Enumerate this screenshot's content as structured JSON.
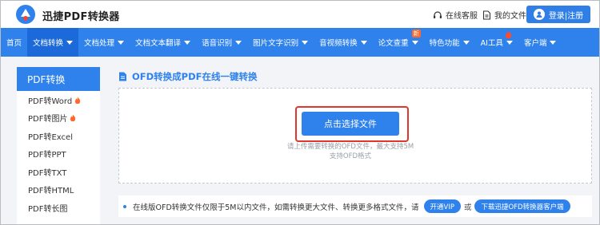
{
  "header": {
    "brand": "迅捷PDF转换器",
    "service": "在线客服",
    "my_files": "我的文件",
    "login": "登录|注册"
  },
  "nav": {
    "items": [
      {
        "label": "首页",
        "caret": false
      },
      {
        "label": "文档转换",
        "caret": true,
        "active": true
      },
      {
        "label": "文档处理",
        "caret": true
      },
      {
        "label": "文档文本翻译",
        "caret": true
      },
      {
        "label": "语音识别",
        "caret": true
      },
      {
        "label": "图片文字识别",
        "caret": true
      },
      {
        "label": "音视频转换",
        "caret": true
      },
      {
        "label": "论文查重",
        "caret": true,
        "badge": "新"
      },
      {
        "label": "特色功能",
        "caret": true
      },
      {
        "label": "AI工具",
        "caret": true,
        "fire": true
      },
      {
        "label": "客户端",
        "caret": true
      }
    ]
  },
  "sidebar": {
    "title": "PDF转换",
    "items": [
      {
        "label": "PDF转Word",
        "hot": true
      },
      {
        "label": "PDF转图片",
        "hot": true
      },
      {
        "label": "PDF转Excel",
        "hot": false
      },
      {
        "label": "PDF转PPT",
        "hot": false
      },
      {
        "label": "PDF转TXT",
        "hot": false
      },
      {
        "label": "PDF转HTML",
        "hot": false
      },
      {
        "label": "PDF转长图",
        "hot": false
      }
    ]
  },
  "main": {
    "title": "OFD转换成PDF在线一键转换",
    "select_button": "点击选择文件",
    "hint_line1": "请上传需要转换的OFD文件，最大支持5M",
    "hint_line2": "支持OFD格式",
    "notice_text": "在线版OFD转换文件仅限于5M以内文件，如需转换更大文件、转换更多格式文件，请",
    "vip_button": "开通VIP",
    "or_text": "或",
    "download_button": "下载迅捷OFD转换器客户端"
  },
  "colors": {
    "primary": "#2f82ec",
    "nav_active": "#1c6ad9",
    "highlight": "#e0362c",
    "hot": "#ff6a2b"
  }
}
